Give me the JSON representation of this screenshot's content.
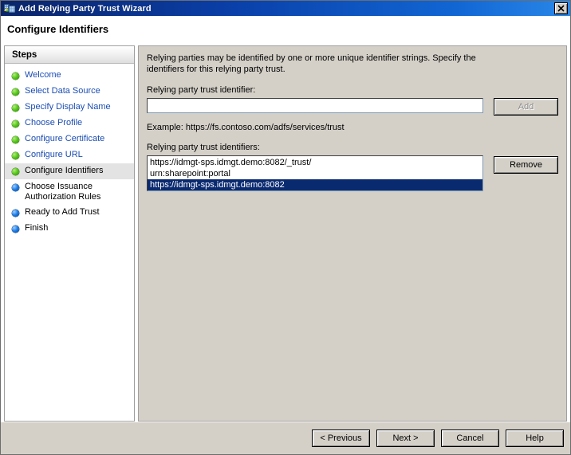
{
  "window": {
    "title": "Add Relying Party Trust Wizard",
    "icon": "wizard-icon",
    "close_label": "✕"
  },
  "header": {
    "title": "Configure Identifiers"
  },
  "sidebar": {
    "header": "Steps",
    "items": [
      {
        "label": "Welcome",
        "state": "done"
      },
      {
        "label": "Select Data Source",
        "state": "done"
      },
      {
        "label": "Specify Display Name",
        "state": "done"
      },
      {
        "label": "Choose Profile",
        "state": "done"
      },
      {
        "label": "Configure Certificate",
        "state": "done"
      },
      {
        "label": "Configure URL",
        "state": "done"
      },
      {
        "label": "Configure Identifiers",
        "state": "current"
      },
      {
        "label": "Choose Issuance Authorization Rules",
        "state": "future"
      },
      {
        "label": "Ready to Add Trust",
        "state": "future"
      },
      {
        "label": "Finish",
        "state": "future"
      }
    ]
  },
  "main": {
    "intro": "Relying parties may be identified by one or more unique identifier strings. Specify the identifiers for this relying party trust.",
    "identifier_label": "Relying party trust identifier:",
    "identifier_value": "",
    "identifier_placeholder": "",
    "add_button": "Add",
    "add_button_enabled": false,
    "example_text": "Example: https://fs.contoso.com/adfs/services/trust",
    "list_label": "Relying party trust identifiers:",
    "remove_button": "Remove",
    "identifiers": [
      {
        "text": "https://idmgt-sps.idmgt.demo:8082/_trust/",
        "selected": false
      },
      {
        "text": "urn:sharepoint:portal",
        "selected": false
      },
      {
        "text": "https://idmgt-sps.idmgt.demo:8082",
        "selected": true
      }
    ]
  },
  "footer": {
    "previous": "< Previous",
    "next": "Next >",
    "cancel": "Cancel",
    "help": "Help"
  },
  "colors": {
    "title_bar_start": "#0a246a",
    "title_bar_end": "#2a87e8",
    "dialog_face": "#d4d0c8",
    "link_blue": "#1b4db3",
    "selection_blue": "#0a2a70",
    "bullet_done_green": "#56c81b",
    "bullet_future_blue": "#1f7ce6"
  }
}
